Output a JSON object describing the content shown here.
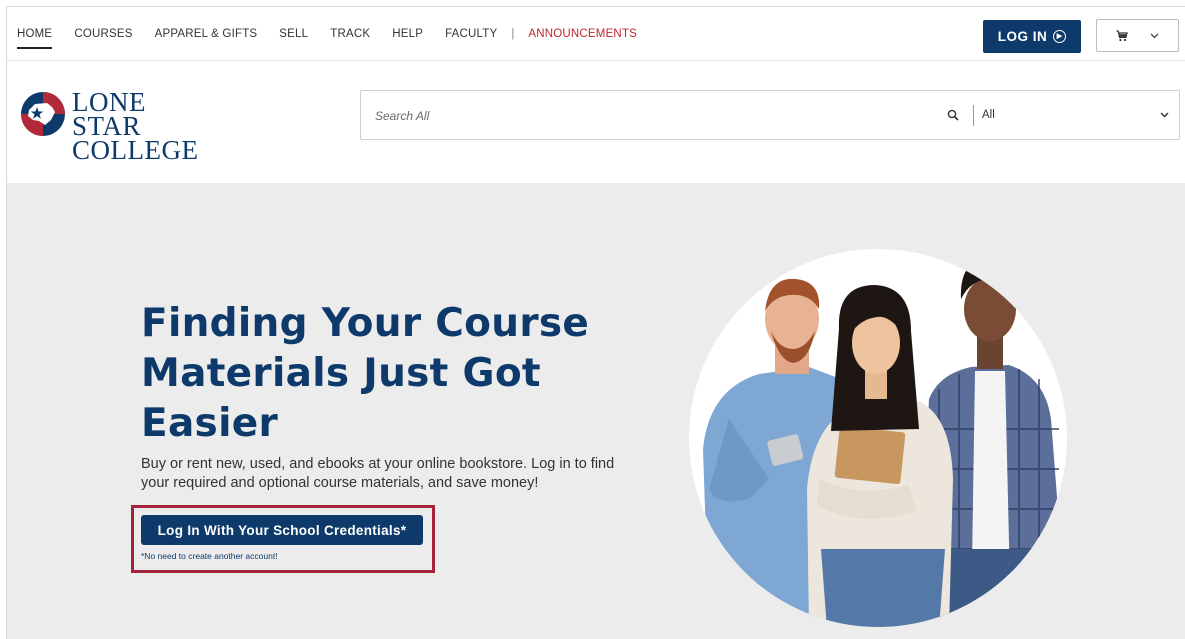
{
  "nav": {
    "links": [
      "HOME",
      "COURSES",
      "APPAREL & GIFTS",
      "SELL",
      "TRACK",
      "HELP",
      "FACULTY"
    ],
    "separator": "|",
    "announcements": "ANNOUNCEMENTS",
    "login_label": "LOG IN",
    "cart_icon": "cart-icon"
  },
  "logo": {
    "line1": "LONE STAR",
    "line2": "COLLEGE"
  },
  "search": {
    "placeholder": "Search All",
    "category": "All"
  },
  "hero": {
    "title": "Finding Your Course Materials Just Got Easier",
    "description": "Buy or rent new, used, and ebooks at your online bookstore. Log in to find your required and optional course materials, and save money!",
    "button_label": "Log In With Your School Credentials*",
    "note": "*No need to create another account!"
  },
  "colors": {
    "brand_navy": "#0e3a6b",
    "announce_red": "#c0262d",
    "highlight_maroon": "#a3243b",
    "hero_bg": "#ececec"
  }
}
